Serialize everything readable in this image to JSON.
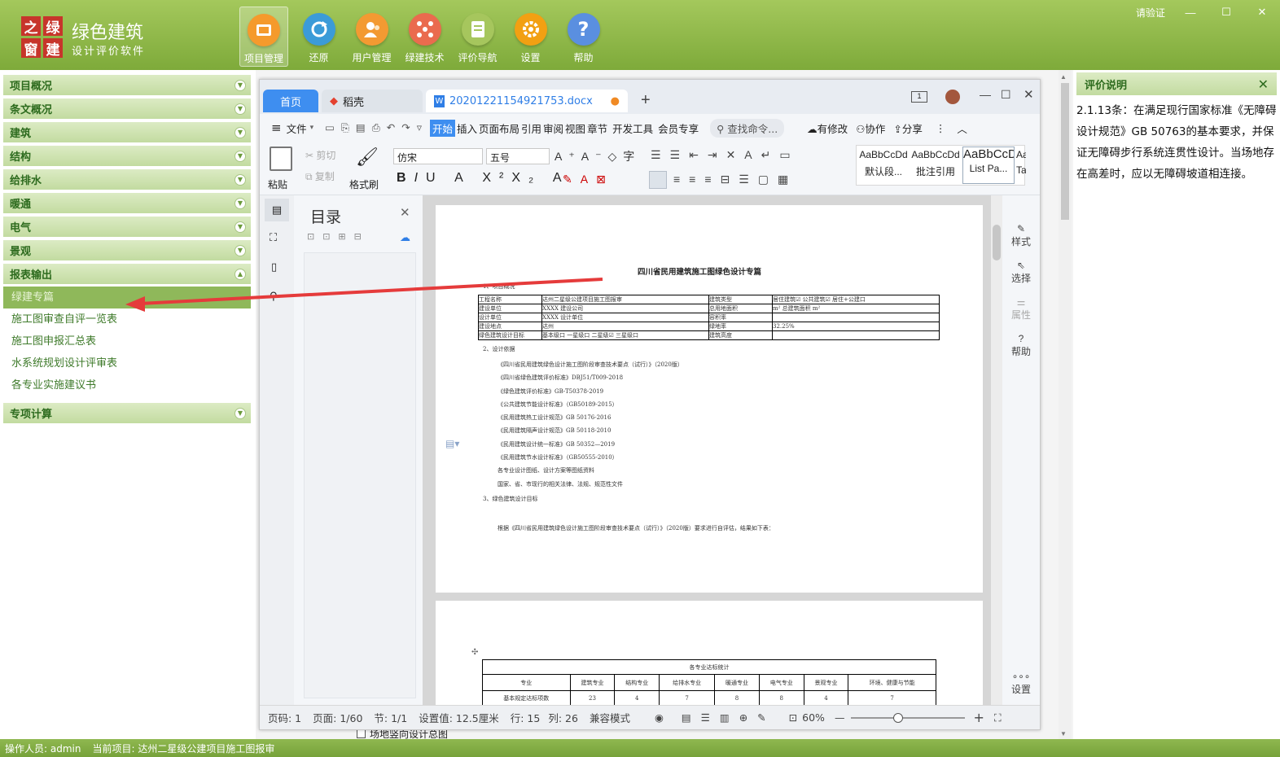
{
  "app": {
    "logo_chars": [
      "之",
      "绿",
      "窗",
      "建"
    ],
    "title": "绿色建筑",
    "subtitle": "设计评价软件",
    "verify": "请验证"
  },
  "main_nav": [
    {
      "label": "项目管理",
      "icon": "folder-icon",
      "color": "#f59a2c"
    },
    {
      "label": "还原",
      "icon": "refresh-icon",
      "color": "#3b9bd8"
    },
    {
      "label": "用户管理",
      "icon": "users-icon",
      "color": "#f39a32"
    },
    {
      "label": "绿建技术",
      "icon": "network-icon",
      "color": "#ea6b4e"
    },
    {
      "label": "评价导航",
      "icon": "document-icon",
      "color": "#a6c65d"
    },
    {
      "label": "设置",
      "icon": "gear-icon",
      "color": "#f2a012"
    },
    {
      "label": "帮助",
      "icon": "help-icon",
      "color": "#5a8fe0"
    }
  ],
  "sidebar": {
    "sections_top": [
      "项目概况",
      "条文概况",
      "建筑",
      "结构",
      "给排水",
      "暖通",
      "电气",
      "景观"
    ],
    "report_section": "报表输出",
    "report_items": [
      "绿建专篇",
      "施工图审查自评一览表",
      "施工图申报汇总表",
      "水系统规划设计评审表",
      "各专业实施建议书"
    ],
    "bottom_section": "专项计算"
  },
  "doc": {
    "tabs": {
      "home": "首页",
      "daoke": "稻壳",
      "file": "20201221154921753.docx"
    },
    "menu": {
      "file": "文件",
      "start": "开始",
      "items": [
        "插入",
        "页面布局",
        "引用",
        "审阅",
        "视图",
        "章节",
        "开发工具",
        "会员专享"
      ],
      "search": "查找命令...",
      "modified": "有修改",
      "collab": "协作",
      "share": "分享"
    },
    "ribbon": {
      "paste": "粘贴",
      "cut": "剪切",
      "copy": "复制",
      "format_painter": "格式刷",
      "font": "仿宋",
      "size": "五号",
      "styles": [
        {
          "preview": "AaBbCcDd",
          "name": "默认段..."
        },
        {
          "preview": "AaBbCcDd",
          "name": "批注引用"
        },
        {
          "preview": "AaBbCcDd",
          "name": "List Pa..."
        },
        {
          "preview": "Aa",
          "name": "Ta"
        }
      ]
    },
    "toc": {
      "title": "目录"
    },
    "right_tools": [
      "样式",
      "选择",
      "属性",
      "帮助",
      "设置"
    ],
    "page1": {
      "title": "四川省民用建筑施工图绿色设计专篇",
      "sec1": "1、项目概况",
      "table": [
        [
          "工程名称",
          "达州二星级公建项目施工图报审",
          "建筑类型",
          "居住建筑☑  公共建筑☑  居住+公建口"
        ],
        [
          "建设单位",
          "XXXX 建设公司",
          "总用地面积",
          "m²  总建筑面积  m²"
        ],
        [
          "设计单位",
          "XXXX 设计单位",
          "容积率",
          ""
        ],
        [
          "建设地点",
          "达州",
          "绿地率",
          "32.25%"
        ],
        [
          "绿色建筑设计目标",
          "基本级口   一星级口   二星级☑   三星级口",
          "建筑高度",
          ""
        ]
      ],
      "sec2": "2、设计依据",
      "refs": [
        "《四川省民用建筑绿色设计施工图阶段审查技术要点（试行）》（2020版）",
        "《四川省绿色建筑评价标准》DBJ51/T009-2018",
        "《绿色建筑评价标准》GB-T50378-2019",
        "《公共建筑节能设计标准》（GB50189-2015）",
        "《民用建筑热工设计规范》GB 50176-2016",
        "《民用建筑隔声设计规范》GB 50118-2010",
        "《民用建筑设计统一标准》GB 50352—2019",
        "《民用建筑节水设计标准》（GB50555-2010）",
        "各专业设计图纸、设计方案等图纸资料",
        "国家、省、市现行的相关法律、法规、规范性文件"
      ],
      "sec3": "3、绿色建筑设计目标",
      "para": "根据《四川省民用建筑绿色设计施工图阶段审查技术要点（试行）》（2020版）要求进行自评估，结果如下表："
    },
    "page2": {
      "caption": "各专业达标统计",
      "headers": [
        "专业",
        "建筑专业",
        "结构专业",
        "给排水专业",
        "暖通专业",
        "电气专业",
        "景观专业",
        "环境、健康与节能"
      ],
      "row_label": "基本规定达标项数",
      "row": [
        "23",
        "4",
        "7",
        "8",
        "8",
        "4",
        "7"
      ]
    },
    "status": {
      "page_num": "页码: 1",
      "pages": "页面: 1/60",
      "section": "节: 1/1",
      "setting": "设置值: 12.5厘米",
      "row": "行: 15",
      "col": "列: 26",
      "compat": "兼容模式",
      "zoom": "60%"
    }
  },
  "peek_text": "场地竖向设计总图",
  "right_panel": {
    "title": "评价说明",
    "text": "2.1.13条：在满足现行国家标准《无障碍设计规范》GB 50763的基本要求，并保证无障碍步行系统连贯性设计。当场地存在高差时，应以无障碍坡道相连接。"
  },
  "bottom": {
    "operator": "操作人员: admin",
    "project": "当前项目: 达州二星级公建项目施工图报审"
  },
  "colors": {
    "theme_green": "#8fb850",
    "arrow": "#e53b3b",
    "accent_blue": "#2f7ee6"
  }
}
